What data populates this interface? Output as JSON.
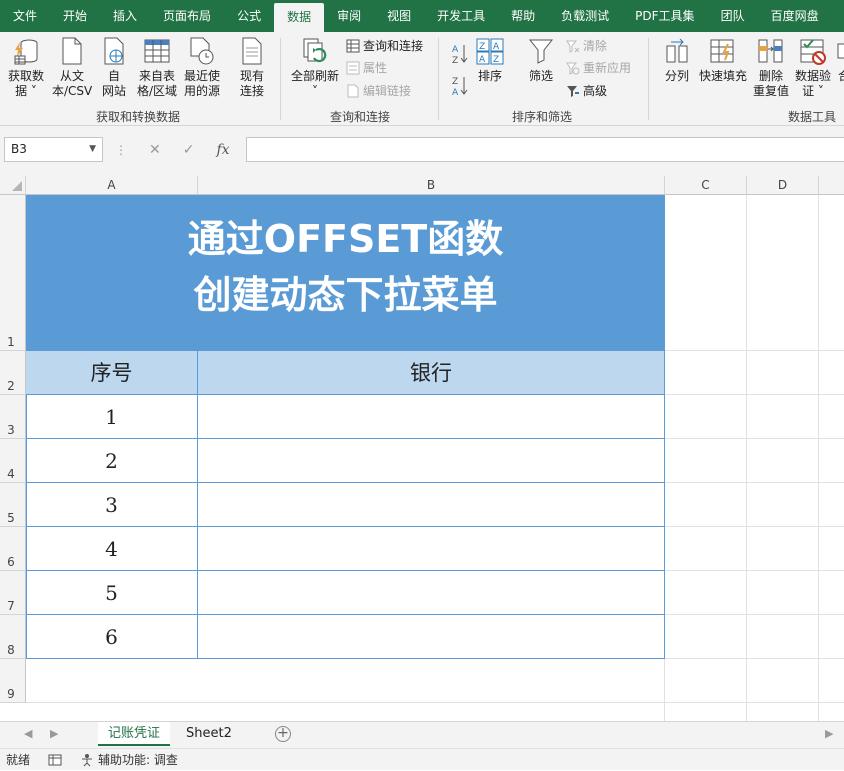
{
  "ribbon_tabs": [
    "文件",
    "开始",
    "插入",
    "页面布局",
    "公式",
    "数据",
    "审阅",
    "视图",
    "开发工具",
    "帮助",
    "负载测试",
    "PDF工具集",
    "团队",
    "百度网盘"
  ],
  "active_tab": "数据",
  "groups": {
    "get_transform": {
      "title": "获取和转换数据",
      "get_data": [
        "获取数",
        "据 ˅"
      ],
      "from_text": [
        "从文",
        "本/CSV"
      ],
      "from_web": [
        "自",
        "网站"
      ],
      "from_table": [
        "来自表",
        "格/区域"
      ],
      "recent_sources": [
        "最近使",
        "用的源"
      ],
      "existing_conn": [
        "现有",
        "连接"
      ]
    },
    "queries": {
      "title": "查询和连接",
      "refresh_all": [
        "全部刷新",
        "˅"
      ],
      "queries_connections": "查询和连接",
      "properties": "属性",
      "edit_links": "编辑链接"
    },
    "sort_filter": {
      "title": "排序和筛选",
      "sort": "排序",
      "filter": "筛选",
      "clear": "清除",
      "reapply": "重新应用",
      "advanced": "高级"
    },
    "data_tools": {
      "title": "数据工具",
      "text_to_columns": "分列",
      "flash_fill": "快速填充",
      "remove_duplicates": [
        "删除",
        "重复值"
      ],
      "data_validation": [
        "数据验",
        "证 ˅"
      ],
      "consolidate_partial": [
        "合"
      ]
    }
  },
  "formula_bar": {
    "name_box": "B3",
    "cancel": "✕",
    "enter": "✓",
    "fx": "fx",
    "formula": ""
  },
  "columns": [
    "A",
    "B",
    "C",
    "D"
  ],
  "rows": [
    "1",
    "2",
    "3",
    "4",
    "5",
    "6",
    "7",
    "8",
    "9"
  ],
  "sheet": {
    "title_line1": "通过OFFSET函数",
    "title_line2": "创建动态下拉菜单",
    "header_no": "序号",
    "header_bank": "银行",
    "numbers": [
      "1",
      "2",
      "3",
      "4",
      "5",
      "6"
    ],
    "banks": [
      "",
      "",
      "",
      "",
      "",
      ""
    ]
  },
  "sheet_tabs": [
    "记账凭证",
    "Sheet2"
  ],
  "active_sheet": "记账凭证",
  "status": {
    "ready": "就绪",
    "accessibility": "辅助功能: 调查"
  },
  "colors": {
    "excel_green": "#217346",
    "title_fill": "#5b9bd5",
    "header_fill": "#bdd7ee",
    "border": "#5b9bd5"
  }
}
